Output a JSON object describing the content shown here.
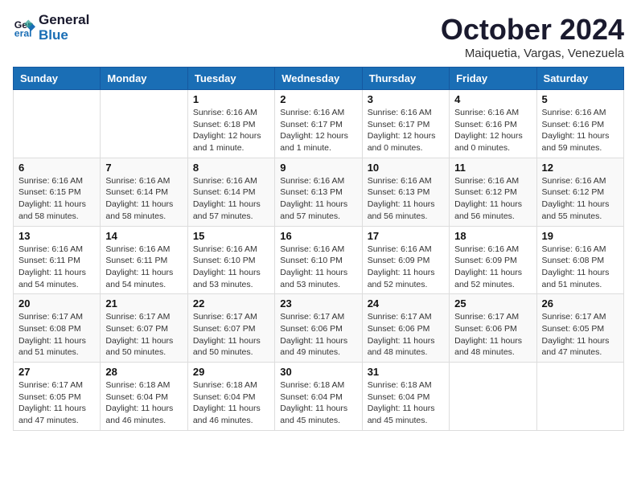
{
  "logo": {
    "line1": "General",
    "line2": "Blue"
  },
  "title": "October 2024",
  "location": "Maiquetia, Vargas, Venezuela",
  "days_of_week": [
    "Sunday",
    "Monday",
    "Tuesday",
    "Wednesday",
    "Thursday",
    "Friday",
    "Saturday"
  ],
  "weeks": [
    [
      {
        "day": "",
        "info": ""
      },
      {
        "day": "",
        "info": ""
      },
      {
        "day": "1",
        "info": "Sunrise: 6:16 AM\nSunset: 6:18 PM\nDaylight: 12 hours\nand 1 minute."
      },
      {
        "day": "2",
        "info": "Sunrise: 6:16 AM\nSunset: 6:17 PM\nDaylight: 12 hours\nand 1 minute."
      },
      {
        "day": "3",
        "info": "Sunrise: 6:16 AM\nSunset: 6:17 PM\nDaylight: 12 hours\nand 0 minutes."
      },
      {
        "day": "4",
        "info": "Sunrise: 6:16 AM\nSunset: 6:16 PM\nDaylight: 12 hours\nand 0 minutes."
      },
      {
        "day": "5",
        "info": "Sunrise: 6:16 AM\nSunset: 6:16 PM\nDaylight: 11 hours\nand 59 minutes."
      }
    ],
    [
      {
        "day": "6",
        "info": "Sunrise: 6:16 AM\nSunset: 6:15 PM\nDaylight: 11 hours\nand 58 minutes."
      },
      {
        "day": "7",
        "info": "Sunrise: 6:16 AM\nSunset: 6:14 PM\nDaylight: 11 hours\nand 58 minutes."
      },
      {
        "day": "8",
        "info": "Sunrise: 6:16 AM\nSunset: 6:14 PM\nDaylight: 11 hours\nand 57 minutes."
      },
      {
        "day": "9",
        "info": "Sunrise: 6:16 AM\nSunset: 6:13 PM\nDaylight: 11 hours\nand 57 minutes."
      },
      {
        "day": "10",
        "info": "Sunrise: 6:16 AM\nSunset: 6:13 PM\nDaylight: 11 hours\nand 56 minutes."
      },
      {
        "day": "11",
        "info": "Sunrise: 6:16 AM\nSunset: 6:12 PM\nDaylight: 11 hours\nand 56 minutes."
      },
      {
        "day": "12",
        "info": "Sunrise: 6:16 AM\nSunset: 6:12 PM\nDaylight: 11 hours\nand 55 minutes."
      }
    ],
    [
      {
        "day": "13",
        "info": "Sunrise: 6:16 AM\nSunset: 6:11 PM\nDaylight: 11 hours\nand 54 minutes."
      },
      {
        "day": "14",
        "info": "Sunrise: 6:16 AM\nSunset: 6:11 PM\nDaylight: 11 hours\nand 54 minutes."
      },
      {
        "day": "15",
        "info": "Sunrise: 6:16 AM\nSunset: 6:10 PM\nDaylight: 11 hours\nand 53 minutes."
      },
      {
        "day": "16",
        "info": "Sunrise: 6:16 AM\nSunset: 6:10 PM\nDaylight: 11 hours\nand 53 minutes."
      },
      {
        "day": "17",
        "info": "Sunrise: 6:16 AM\nSunset: 6:09 PM\nDaylight: 11 hours\nand 52 minutes."
      },
      {
        "day": "18",
        "info": "Sunrise: 6:16 AM\nSunset: 6:09 PM\nDaylight: 11 hours\nand 52 minutes."
      },
      {
        "day": "19",
        "info": "Sunrise: 6:16 AM\nSunset: 6:08 PM\nDaylight: 11 hours\nand 51 minutes."
      }
    ],
    [
      {
        "day": "20",
        "info": "Sunrise: 6:17 AM\nSunset: 6:08 PM\nDaylight: 11 hours\nand 51 minutes."
      },
      {
        "day": "21",
        "info": "Sunrise: 6:17 AM\nSunset: 6:07 PM\nDaylight: 11 hours\nand 50 minutes."
      },
      {
        "day": "22",
        "info": "Sunrise: 6:17 AM\nSunset: 6:07 PM\nDaylight: 11 hours\nand 50 minutes."
      },
      {
        "day": "23",
        "info": "Sunrise: 6:17 AM\nSunset: 6:06 PM\nDaylight: 11 hours\nand 49 minutes."
      },
      {
        "day": "24",
        "info": "Sunrise: 6:17 AM\nSunset: 6:06 PM\nDaylight: 11 hours\nand 48 minutes."
      },
      {
        "day": "25",
        "info": "Sunrise: 6:17 AM\nSunset: 6:06 PM\nDaylight: 11 hours\nand 48 minutes."
      },
      {
        "day": "26",
        "info": "Sunrise: 6:17 AM\nSunset: 6:05 PM\nDaylight: 11 hours\nand 47 minutes."
      }
    ],
    [
      {
        "day": "27",
        "info": "Sunrise: 6:17 AM\nSunset: 6:05 PM\nDaylight: 11 hours\nand 47 minutes."
      },
      {
        "day": "28",
        "info": "Sunrise: 6:18 AM\nSunset: 6:04 PM\nDaylight: 11 hours\nand 46 minutes."
      },
      {
        "day": "29",
        "info": "Sunrise: 6:18 AM\nSunset: 6:04 PM\nDaylight: 11 hours\nand 46 minutes."
      },
      {
        "day": "30",
        "info": "Sunrise: 6:18 AM\nSunset: 6:04 PM\nDaylight: 11 hours\nand 45 minutes."
      },
      {
        "day": "31",
        "info": "Sunrise: 6:18 AM\nSunset: 6:04 PM\nDaylight: 11 hours\nand 45 minutes."
      },
      {
        "day": "",
        "info": ""
      },
      {
        "day": "",
        "info": ""
      }
    ]
  ]
}
